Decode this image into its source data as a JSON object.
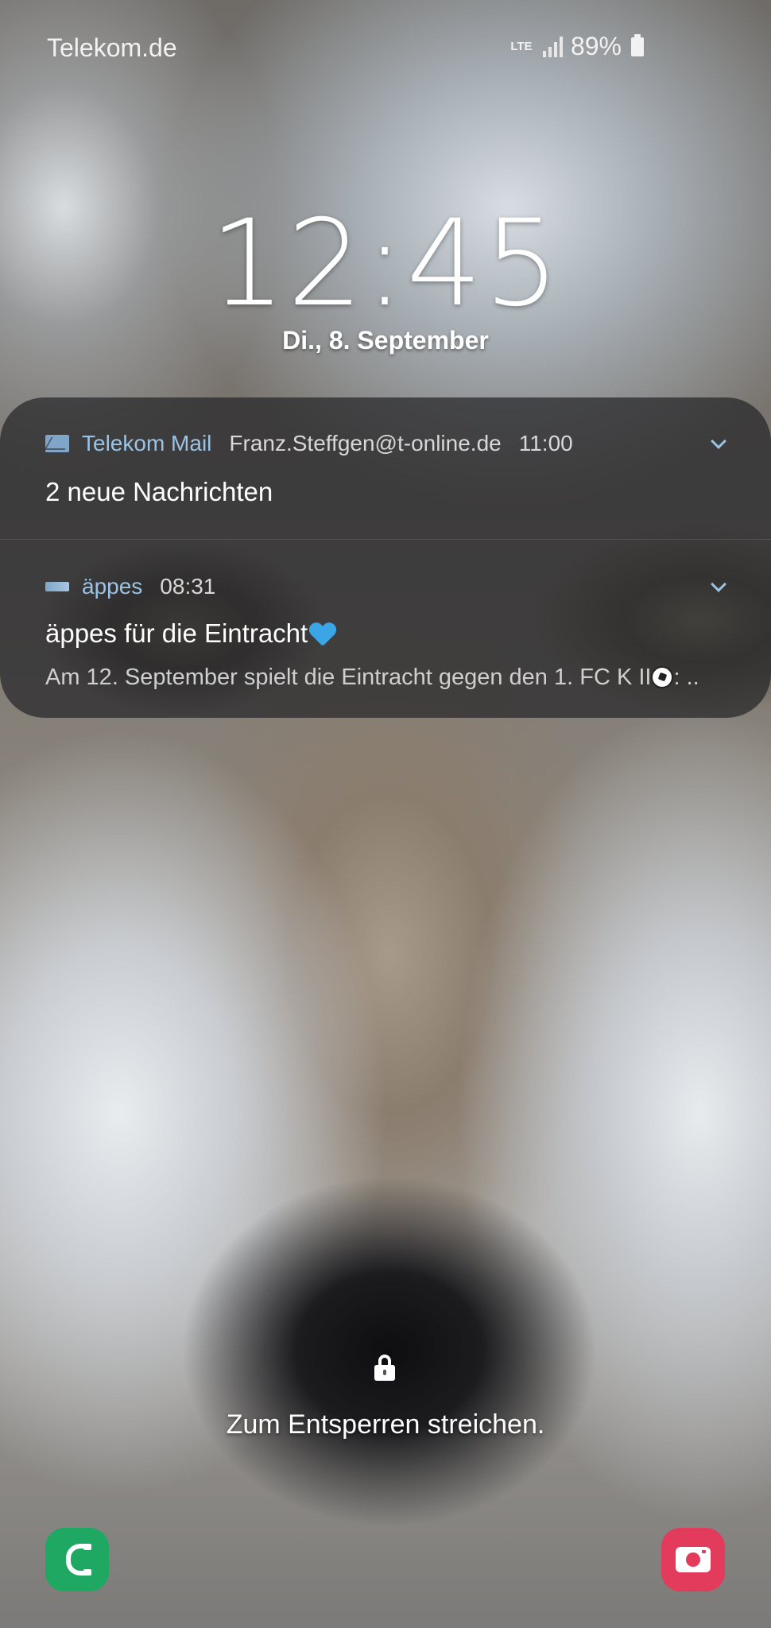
{
  "status_bar": {
    "carrier": "Telekom.de",
    "network": "LTE",
    "battery": "89%"
  },
  "lockscreen": {
    "time": "12:45",
    "date": "Di., 8. September",
    "unlock_hint": "Zum Entsperren streichen."
  },
  "notifications": [
    {
      "app": "Telekom Mail",
      "account": "Franz.Steffgen@t-online.de",
      "time": "11:00",
      "title": "2 neue Nachrichten",
      "icon": "mail-icon"
    },
    {
      "app": "äppes",
      "time": "08:31",
      "title": "äppes für die Eintracht",
      "body": "Am 12. September spielt die Eintracht gegen den 1. FC K II",
      "body_suffix": ": ..",
      "icon": "appes-icon"
    }
  ],
  "shortcuts": {
    "left": "phone-icon",
    "right": "camera-icon"
  },
  "colors": {
    "accent": "#9cc3e4",
    "phone": "#1fa861",
    "camera": "#e23b5c"
  }
}
